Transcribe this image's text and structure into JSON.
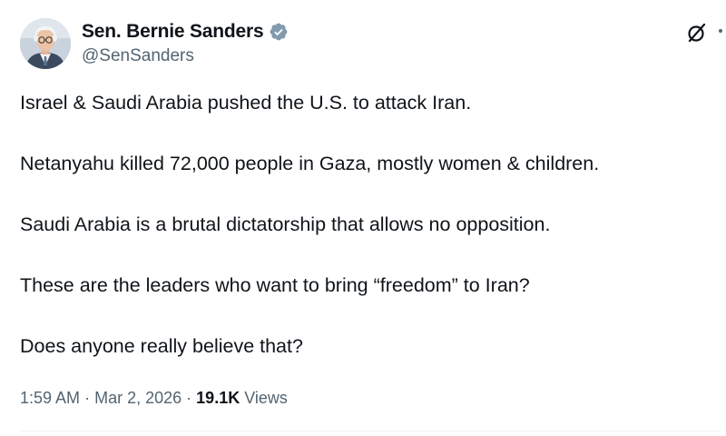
{
  "author": {
    "display_name": "Sen. Bernie Sanders",
    "handle": "@SenSanders",
    "verified": true,
    "verified_color": "#829aab"
  },
  "post": {
    "paragraphs": [
      "Israel & Saudi Arabia pushed the U.S. to attack Iran.",
      "Netanyahu killed 72,000 people in Gaza, mostly women & children.",
      "Saudi Arabia is a brutal dictatorship that allows no opposition.",
      "These are the leaders who want to bring “freedom” to Iran?",
      "Does anyone really believe that?"
    ]
  },
  "meta": {
    "time": "1:59 AM",
    "separator": "·",
    "date": "Mar 2, 2026",
    "views_count": "19.1K",
    "views_label": "Views"
  },
  "icons": {
    "header_action": "grok-icon",
    "verified": "verified-badge-icon",
    "more": "more-icon"
  },
  "colors": {
    "text_primary": "#0f1419",
    "text_secondary": "#536471",
    "divider": "#eff3f4"
  }
}
